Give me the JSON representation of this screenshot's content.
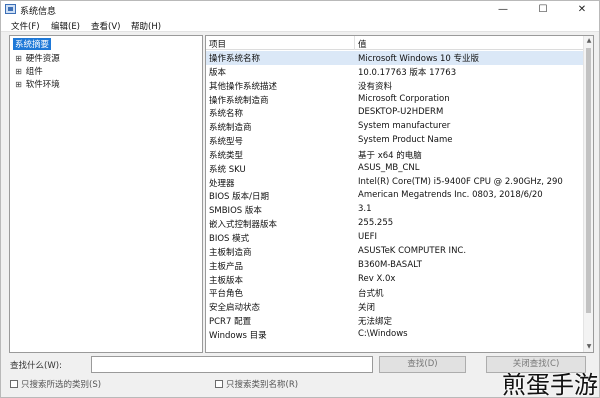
{
  "window": {
    "title": "系统信息",
    "controls": {
      "minimize": "—",
      "maximize": "☐",
      "close": "✕"
    }
  },
  "menu": [
    "文件(F)",
    "编辑(E)",
    "查看(V)",
    "帮助(H)"
  ],
  "tree": {
    "root": "系统摘要",
    "children": [
      {
        "expander": "⊞",
        "label": "硬件资源"
      },
      {
        "expander": "⊞",
        "label": "组件"
      },
      {
        "expander": "⊞",
        "label": "软件环境"
      }
    ]
  },
  "list": {
    "headers": {
      "item": "项目",
      "value": "值"
    },
    "rows": [
      {
        "item": "操作系统名称",
        "value": "Microsoft Windows 10 专业版"
      },
      {
        "item": "版本",
        "value": "10.0.17763 版本 17763"
      },
      {
        "item": "其他操作系统描述",
        "value": "没有资料"
      },
      {
        "item": "操作系统制造商",
        "value": "Microsoft Corporation"
      },
      {
        "item": "系统名称",
        "value": "DESKTOP-U2HDERM"
      },
      {
        "item": "系统制造商",
        "value": "System manufacturer"
      },
      {
        "item": "系统型号",
        "value": "System Product Name"
      },
      {
        "item": "系统类型",
        "value": "基于 x64 的电脑"
      },
      {
        "item": "系统 SKU",
        "value": "ASUS_MB_CNL"
      },
      {
        "item": "处理器",
        "value": "Intel(R) Core(TM) i5-9400F CPU @ 2.90GHz, 290"
      },
      {
        "item": "BIOS 版本/日期",
        "value": "American Megatrends Inc. 0803, 2018/6/20"
      },
      {
        "item": "SMBIOS 版本",
        "value": "3.1"
      },
      {
        "item": "嵌入式控制器版本",
        "value": "255.255"
      },
      {
        "item": "BIOS 模式",
        "value": "UEFI"
      },
      {
        "item": "主板制造商",
        "value": "ASUSTeK COMPUTER INC."
      },
      {
        "item": "主板产品",
        "value": "B360M-BASALT"
      },
      {
        "item": "主板版本",
        "value": "Rev X.0x"
      },
      {
        "item": "平台角色",
        "value": "台式机"
      },
      {
        "item": "安全启动状态",
        "value": "关闭"
      },
      {
        "item": "PCR7 配置",
        "value": "无法绑定"
      },
      {
        "item": "Windows 目录",
        "value": "C:\\Windows"
      }
    ],
    "selected_index": 0,
    "scrollbar": {
      "up": "▲",
      "down": "▼"
    }
  },
  "find": {
    "label": "查找什么(W):",
    "value": "",
    "find_button": "查找(D)",
    "close_button": "关闭查找(C)",
    "option_selected_category": "只搜索所选的类别(S)",
    "option_category_names": "只搜索类别名称(R)"
  },
  "watermark": "煎蛋手游"
}
